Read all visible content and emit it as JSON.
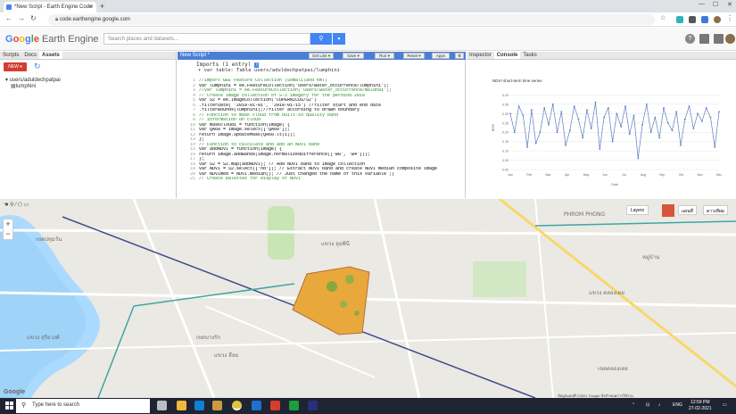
{
  "browser": {
    "tab_title": "*New Script - Earth Engine Code",
    "new_tab": "+",
    "url": "code.earthengine.google.com"
  },
  "gee": {
    "logo_google": [
      "G",
      "o",
      "o",
      "g",
      "l",
      "e"
    ],
    "logo_ee": "Earth Engine",
    "search_placeholder": "Search places and datasets..."
  },
  "left_panel": {
    "tabs": [
      "Scripts",
      "Docs",
      "Assets"
    ],
    "active_tab": "Assets",
    "new_button": "NEW ▾",
    "user": "users/aduldechpatpai",
    "asset": "lumphini"
  },
  "editor": {
    "tab_title": "New Script *",
    "buttons": [
      "Get Link ▾",
      "Save ▾",
      "Run ▾",
      "Reset ▾",
      "Apps"
    ],
    "imports_title": "Imports (1 entry)",
    "imports_var": "▾ var table: Table users/aduldechpatpai/lumphini",
    "code_lines": [
      {
        "n": "1",
        "t": "//Import GEE Feature Collection (Somaliland kml)",
        "c": true
      },
      {
        "n": "2",
        "t": "var lumphini = ee.FeatureCollection('users/water_occurrence/lumphini');",
        "c": false
      },
      {
        "n": "3",
        "t": "//var lumphini = ee.FeatureCollection('users/water_occurrence/maldhai');",
        "c": true
      },
      {
        "n": "4",
        "t": "// Create image collection of S-2 imagery for the perdiod 2018",
        "c": true
      },
      {
        "n": "5",
        "t": "var S2 = ee.ImageCollection('COPERNICUS/S2')",
        "c": false
      },
      {
        "n": "6",
        "t": "  .filterDate( '2018-01-01', '2018-01-15') //filter start and end date",
        "c": false
      },
      {
        "n": "7",
        "t": "  .filterBounds(lumphini);//filter according to drawn boundary",
        "c": false
      },
      {
        "n": "8",
        "t": "// Function to mask cloud from built-in quality band",
        "c": true
      },
      {
        "n": "9",
        "t": "// information on cloud",
        "c": true
      },
      {
        "n": "10",
        "t": "var maskcloud1 = function(image) {",
        "c": false
      },
      {
        "n": "11",
        "t": "var QA60 = image.select(['QA60']);",
        "c": false
      },
      {
        "n": "12",
        "t": "return image.updateMask(QA60.lt(1));",
        "c": false
      },
      {
        "n": "13",
        "t": "};",
        "c": false
      },
      {
        "n": "14",
        "t": "// Function to calculate and add an NDVI band",
        "c": true
      },
      {
        "n": "15",
        "t": "var addNDVI = function(image) {",
        "c": false
      },
      {
        "n": "16",
        "t": "return image.addBands(image.normalizedDifference(['B8', 'B4']));",
        "c": false
      },
      {
        "n": "17",
        "t": "};",
        "c": false
      },
      {
        "n": "18",
        "t": "var S2 = S2.map(addNDVI); // Add NDVI band to image collection",
        "c": false
      },
      {
        "n": "19",
        "t": "var NDVI = S2.select(['nd']); // Extract NDVI band and create NDVI median composite image",
        "c": false
      },
      {
        "n": "20",
        "t": "var NDVImed = NDVI.median(); // Just changed the name of this variable ;)",
        "c": false
      },
      {
        "n": "21",
        "t": "// Create palettes for display of NDVI",
        "c": true
      }
    ]
  },
  "right_panel": {
    "tabs": [
      "Inspector",
      "Console",
      "Tasks"
    ],
    "active_tab": "Console"
  },
  "chart_data": {
    "type": "line",
    "title": "NDVI short-term time series",
    "xlabel": "Date",
    "ylabel": "NDVI",
    "x": [
      "Jan",
      "Feb",
      "Mar",
      "Apr",
      "May",
      "Jun",
      "Jul",
      "Aug",
      "Sep",
      "Oct",
      "Nov",
      "Dec"
    ],
    "ylim": [
      0,
      0.45
    ],
    "yticks": [
      "0.40",
      "0.35",
      "0.30",
      "0.25",
      "0.20",
      "0.15",
      "0.10",
      "0.05",
      "0.00"
    ],
    "values": [
      0.3,
      0.2,
      0.34,
      0.29,
      0.12,
      0.32,
      0.14,
      0.2,
      0.33,
      0.24,
      0.35,
      0.2,
      0.31,
      0.13,
      0.21,
      0.34,
      0.27,
      0.17,
      0.32,
      0.22,
      0.36,
      0.11,
      0.28,
      0.33,
      0.15,
      0.3,
      0.23,
      0.34,
      0.19,
      0.29,
      0.06,
      0.24,
      0.35,
      0.2,
      0.28,
      0.17,
      0.33,
      0.25,
      0.21,
      0.31,
      0.13,
      0.27,
      0.34,
      0.22,
      0.3,
      0.26,
      0.33,
      0.28,
      0.12,
      0.31
    ],
    "color": "#5b7fbf"
  },
  "map": {
    "tools": "☚ ⚲ ⁄ ⬠ ▭",
    "zoom_in": "+",
    "zoom_out": "−",
    "layers_btn": "Layers",
    "map_btn": "แผนที่",
    "sat_btn": "ดาวเทียม",
    "google": "Google",
    "attribution": "ข้อมูลแผนที่ ©2021 Google  ข้อกำหนดการใช้งาน",
    "labels": [
      {
        "t": "แขวง ลุมพินี",
        "k": "a"
      },
      {
        "t": "PHROM PHONG",
        "k": "b"
      },
      {
        "t": "เขตปทุมวัน",
        "k": "c"
      },
      {
        "t": "แขวง สีลม",
        "k": "d"
      },
      {
        "t": "เขตบางรัก",
        "k": "e"
      },
      {
        "t": "แขวง คลองเตย",
        "k": "f"
      },
      {
        "t": "เขตคลองเตย",
        "k": "g"
      },
      {
        "t": "แขวง สุริยวงศ์",
        "k": "h"
      },
      {
        "t": "หมู่บ้าน",
        "k": "i"
      }
    ],
    "ndvi_color": "#e8a83c"
  },
  "taskbar": {
    "search": "Type here to search",
    "time": "12:59 PM",
    "date": "27-02-2021",
    "lang": "ENG"
  }
}
